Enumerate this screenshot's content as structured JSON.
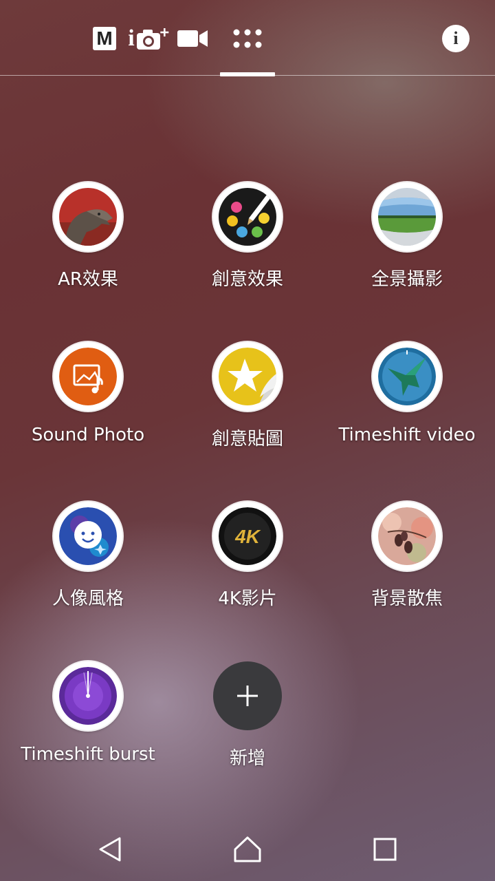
{
  "topbar": {
    "modes": [
      {
        "icon": "manual-mode-icon",
        "text": "M"
      },
      {
        "icon": "superior-auto-icon",
        "text": "i"
      },
      {
        "icon": "video-camera-icon"
      },
      {
        "icon": "camera-apps-grid-icon"
      }
    ],
    "info_icon": "info-icon",
    "info_text": "i"
  },
  "apps": [
    {
      "label": "AR效果",
      "icon": "ar-effect-dinosaur-icon"
    },
    {
      "label": "創意效果",
      "icon": "creative-effect-palette-icon"
    },
    {
      "label": "全景攝影",
      "icon": "panorama-landscape-icon"
    },
    {
      "label": "Sound Photo",
      "icon": "sound-photo-icon"
    },
    {
      "label": "創意貼圖",
      "icon": "sticker-creator-star-icon"
    },
    {
      "label": "Timeshift video",
      "icon": "timeshift-video-hummingbird-icon"
    },
    {
      "label": "人像風格",
      "icon": "portrait-style-face-icon"
    },
    {
      "label": "4K影片",
      "icon": "4k-video-icon",
      "text": "4K"
    },
    {
      "label": "背景散焦",
      "icon": "background-defocus-icon"
    },
    {
      "label": "Timeshift burst",
      "icon": "timeshift-burst-icon"
    }
  ],
  "add": {
    "label": "新增",
    "icon": "plus-icon"
  },
  "navbar": {
    "back_icon": "back-icon",
    "home_icon": "home-icon",
    "recents_icon": "recents-icon"
  },
  "colors": {
    "accent": "#ffffff",
    "add_button": "#3a3a3d"
  }
}
